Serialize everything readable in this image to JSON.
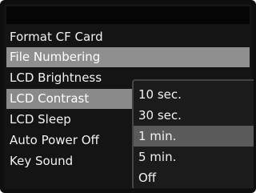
{
  "menu": {
    "items": [
      {
        "label": "Format CF Card"
      },
      {
        "label": "File Numbering"
      },
      {
        "label": "LCD Brightness"
      },
      {
        "label": "LCD Contrast"
      },
      {
        "label": "LCD Sleep"
      },
      {
        "label": "Auto Power Off"
      },
      {
        "label": "Key Sound"
      }
    ]
  },
  "submenu": {
    "options": [
      {
        "label": "10 sec."
      },
      {
        "label": "30 sec."
      },
      {
        "label": "1 min."
      },
      {
        "label": "5 min."
      },
      {
        "label": "Off"
      }
    ],
    "selected": "1 min."
  },
  "colors": {
    "background": "#141414",
    "highlight": "#8f8f8f",
    "submenu_highlight": "#5a5a5a",
    "text": "#f2f2f2"
  }
}
